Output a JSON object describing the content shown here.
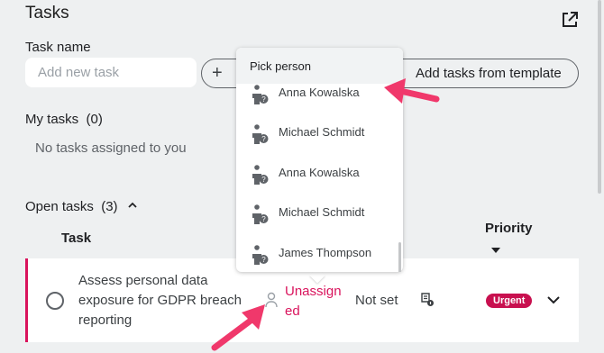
{
  "header": {
    "title": "Tasks",
    "open_external_icon": "external-link-icon"
  },
  "task_form": {
    "label": "Task name",
    "placeholder": "Add new task",
    "add_icon": "plus-icon",
    "template_button_label": "Add tasks from template"
  },
  "my_tasks": {
    "label": "My tasks",
    "count": "(0)",
    "empty_text": "No tasks assigned to you"
  },
  "open_tasks": {
    "label": "Open tasks",
    "count": "(3)",
    "collapse_icon": "chevron-up-icon",
    "columns": {
      "task": "Task",
      "priority": "Priority"
    },
    "rows": [
      {
        "title": "Assess personal data exposure for GDPR breach reporting",
        "assignee": "Unassigned",
        "due": "Not set",
        "priority": "Urgent",
        "row_icon": "document-info-icon"
      }
    ]
  },
  "person_picker": {
    "title": "Pick person",
    "people": [
      {
        "name": "Anna Kowalska"
      },
      {
        "name": "Michael Schmidt"
      },
      {
        "name": "Anna Kowalska"
      },
      {
        "name": "Michael Schmidt"
      },
      {
        "name": "James Thompson"
      }
    ]
  },
  "colors": {
    "accent": "#d9135c",
    "badge": "#c8104f",
    "annotation": "#f0386b",
    "background": "#eef0f1"
  }
}
